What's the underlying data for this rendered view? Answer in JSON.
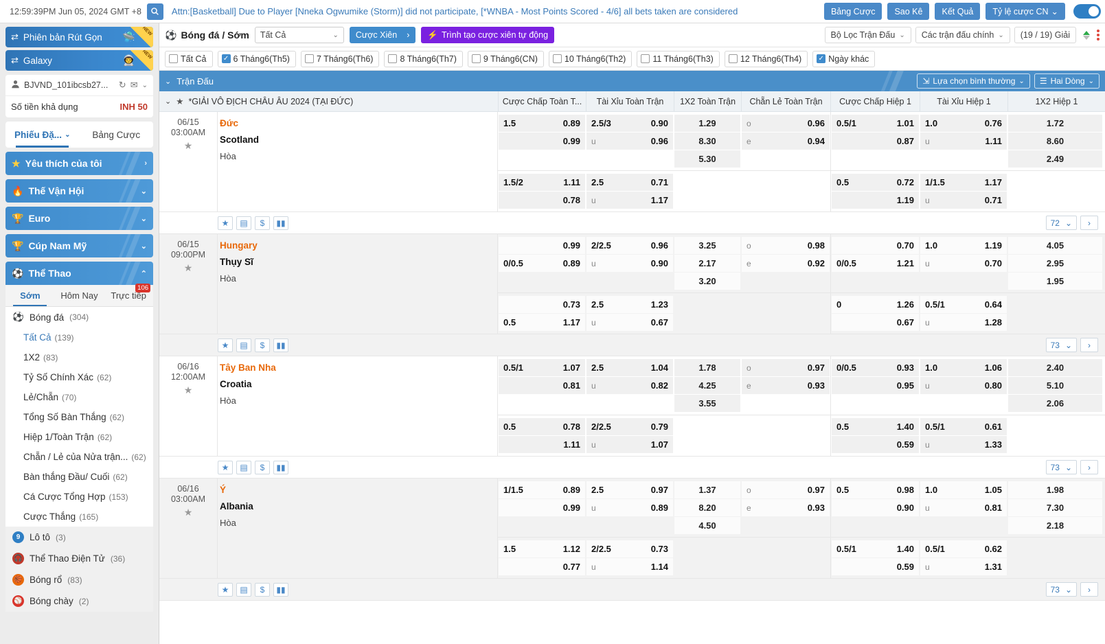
{
  "topbar": {
    "clock": "12:59:39PM Jun 05, 2024 GMT +8",
    "search_icon": "search-icon",
    "announcement": "Attn:[Basketball] Due to Player [Nneka Ogwumike (Storm)] did not participate, [*WNBA - Most Points Scored - 4/6] all bets taken are considered",
    "buttons": [
      {
        "label": "Bảng Cược"
      },
      {
        "label": "Sao Kê"
      },
      {
        "label": "Kết Quả"
      },
      {
        "label": "Tỷ lệ cược CN",
        "caret": "⌄"
      }
    ]
  },
  "sidebar": {
    "promos": [
      {
        "label": "Phiên bản Rút Gọn",
        "flag": "NEW",
        "icon": "swap-icon",
        "deco": "🛸"
      },
      {
        "label": "Galaxy",
        "flag": "NEW",
        "icon": "swap-icon",
        "deco": "👨‍🚀"
      }
    ],
    "account": {
      "name": "BJVND_101ibcsb27...",
      "refresh_icon": "refresh-icon",
      "mail_icon": "mail-icon",
      "caret_icon": "chevron-down-icon",
      "balance_label": "Số tiền khả dụng",
      "balance_value": "INH 50"
    },
    "bet_tabs": [
      {
        "label": "Phiếu Đặ...",
        "active": true,
        "caret": "⌄"
      },
      {
        "label": "Bảng Cược",
        "active": false
      }
    ],
    "nav_groups": [
      {
        "label": "Yêu thích của tôi",
        "icon": "star-icon",
        "caret": "›"
      },
      {
        "label": "Thế Vận Hội",
        "icon": "torch-icon",
        "caret": "⌄"
      },
      {
        "label": "Euro",
        "icon": "trophy-icon",
        "caret": "⌄"
      },
      {
        "label": "Cúp Nam Mỹ",
        "icon": "cup-icon",
        "caret": "⌄"
      }
    ],
    "sports_group": {
      "label": "Thể Thao",
      "icon": "soccer-ball-icon",
      "caret": "⌃",
      "subtabs": [
        {
          "label": "Sớm",
          "active": true
        },
        {
          "label": "Hôm Nay",
          "active": false
        },
        {
          "label": "Trực tiếp",
          "active": false,
          "badge": "106"
        }
      ],
      "primary": {
        "label": "Bóng đá",
        "count": "(304)",
        "icon": "soccer-ball-icon"
      },
      "markets": [
        {
          "label": "Tất Cả",
          "count": "(139)",
          "selected": true
        },
        {
          "label": "1X2",
          "count": "(83)",
          "selected": false
        },
        {
          "label": "Tỷ Số Chính Xác",
          "count": "(62)",
          "selected": false
        },
        {
          "label": "Lẻ/Chẵn",
          "count": "(70)",
          "selected": false
        },
        {
          "label": "Tổng Số Bàn Thắng",
          "count": "(62)",
          "selected": false
        },
        {
          "label": "Hiệp 1/Toàn Trận",
          "count": "(62)",
          "selected": false
        },
        {
          "label": "Chẵn / Lẻ của Nửa trận...",
          "count": "(62)",
          "selected": false
        },
        {
          "label": "Bàn thắng Đầu/ Cuối",
          "count": "(62)",
          "selected": false
        },
        {
          "label": "Cá Cược Tổng Hợp",
          "count": "(153)",
          "selected": false
        },
        {
          "label": "Cược Thắng",
          "count": "(165)",
          "selected": false
        }
      ],
      "other_sports": [
        {
          "label": "Lô tô",
          "count": "(3)",
          "icon": "lotto-icon",
          "color": "#2f7fc4"
        },
        {
          "label": "Thể Thao Điện Tử",
          "count": "(36)",
          "icon": "headset-icon",
          "color": "#c0392b"
        },
        {
          "label": "Bóng rổ",
          "count": "(83)",
          "icon": "basketball-icon",
          "color": "#e8690b"
        },
        {
          "label": "Bóng chày",
          "count": "(2)",
          "icon": "baseball-icon",
          "color": "#d9352c"
        }
      ]
    }
  },
  "subbar": {
    "title": "Bóng đá / Sớm",
    "title_icon": "soccer-ball-icon",
    "filter_value": "Tất Cả",
    "parlay_label": "Cược Xiên",
    "parlay_arrow": "›",
    "auto_parlay_label": "Trình tạo cược xiên tự động",
    "auto_parlay_icon": "lightning-icon",
    "match_filter_label": "Bộ Lọc Trận Đấu",
    "main_matches_label": "Các trận đấu chính",
    "league_count_label": "(19 / 19) Giải",
    "sort_icon": "sort-arrows-icon"
  },
  "dates": [
    {
      "label": "Tất Cả",
      "checked": false
    },
    {
      "label": "6 Tháng6(Th5)",
      "checked": true
    },
    {
      "label": "7 Tháng6(Th6)",
      "checked": false
    },
    {
      "label": "8 Tháng6(Th7)",
      "checked": false
    },
    {
      "label": "9 Tháng6(CN)",
      "checked": false
    },
    {
      "label": "10 Tháng6(Th2)",
      "checked": false
    },
    {
      "label": "11 Tháng6(Th3)",
      "checked": false
    },
    {
      "label": "12 Tháng6(Th4)",
      "checked": false
    },
    {
      "label": "Ngày khác",
      "checked": true
    }
  ],
  "table_header": {
    "caret": "⌄",
    "label": "Trận Đấu",
    "view_option_label": "Lựa chọn bình thường",
    "view_option_icon": "filter-lines-icon",
    "rows_label": "Hai Dòng",
    "rows_icon": "list-icon"
  },
  "league": {
    "caret": "⌄",
    "star_icon": "star-icon",
    "name": "*GIẢI VÔ ĐỊCH CHÂU ÂU 2024 (TẠI ĐỨC)",
    "columns": [
      "Cược Chấp Toàn T...",
      "Tài Xỉu Toàn Trận",
      "1X2 Toàn Trận",
      "Chẵn Lẻ Toàn Trận",
      "Cược Chấp Hiệp 1",
      "Tài Xỉu Hiệp 1",
      "1X2 Hiệp 1"
    ]
  },
  "action_icons": [
    {
      "name": "star-icon",
      "glyph": "★"
    },
    {
      "name": "stack-icon",
      "glyph": "▤"
    },
    {
      "name": "dollar-icon",
      "glyph": "$"
    },
    {
      "name": "bar-chart-icon",
      "glyph": "▮▮"
    }
  ],
  "matches": [
    {
      "date": "06/15",
      "time": "03:00AM",
      "home": "Đức",
      "away": "Scotland",
      "draw": "Hòa",
      "alt": false,
      "pager_value": "72",
      "full": {
        "handicap": [
          {
            "hd": "1.5",
            "val": "0.89"
          },
          {
            "hd": "",
            "val": "0.99"
          }
        ],
        "overunder": [
          {
            "hd": "2.5/3",
            "val": "0.90"
          },
          {
            "hd": "u",
            "val": "0.96"
          }
        ],
        "onextwo": [
          "1.29",
          "8.30",
          "5.30"
        ],
        "oddeven": [
          {
            "hd": "o",
            "val": "0.96"
          },
          {
            "hd": "e",
            "val": "0.94"
          }
        ],
        "h1_handicap": [
          {
            "hd": "0.5/1",
            "val": "1.01"
          },
          {
            "hd": "",
            "val": "0.87"
          }
        ],
        "h1_overunder": [
          {
            "hd": "1.0",
            "val": "0.76"
          },
          {
            "hd": "u",
            "val": "1.11"
          }
        ],
        "h1_onextwo": [
          "1.72",
          "8.60",
          "2.49"
        ]
      },
      "second": {
        "handicap": [
          {
            "hd": "1.5/2",
            "val": "1.11"
          },
          {
            "hd": "",
            "val": "0.78"
          }
        ],
        "overunder": [
          {
            "hd": "2.5",
            "val": "0.71"
          },
          {
            "hd": "u",
            "val": "1.17"
          }
        ],
        "h1_handicap": [
          {
            "hd": "0.5",
            "val": "0.72"
          },
          {
            "hd": "",
            "val": "1.19"
          }
        ],
        "h1_overunder": [
          {
            "hd": "1/1.5",
            "val": "1.17"
          },
          {
            "hd": "u",
            "val": "0.71"
          }
        ]
      }
    },
    {
      "date": "06/15",
      "time": "09:00PM",
      "home": "Hungary",
      "away": "Thụy Sĩ",
      "draw": "Hòa",
      "alt": true,
      "home_highlight": false,
      "pager_value": "73",
      "full": {
        "handicap": [
          {
            "hd": "",
            "val": "0.99"
          },
          {
            "hd": "0/0.5",
            "val": "0.89"
          }
        ],
        "overunder": [
          {
            "hd": "2/2.5",
            "val": "0.96"
          },
          {
            "hd": "u",
            "val": "0.90"
          }
        ],
        "onextwo": [
          "3.25",
          "2.17",
          "3.20"
        ],
        "oddeven": [
          {
            "hd": "o",
            "val": "0.98"
          },
          {
            "hd": "e",
            "val": "0.92"
          }
        ],
        "h1_handicap": [
          {
            "hd": "",
            "val": "0.70"
          },
          {
            "hd": "0/0.5",
            "val": "1.21"
          }
        ],
        "h1_overunder": [
          {
            "hd": "1.0",
            "val": "1.19"
          },
          {
            "hd": "u",
            "val": "0.70"
          }
        ],
        "h1_onextwo": [
          "4.05",
          "2.95",
          "1.95"
        ]
      },
      "second": {
        "handicap": [
          {
            "hd": "",
            "val": "0.73"
          },
          {
            "hd": "0.5",
            "val": "1.17"
          }
        ],
        "overunder": [
          {
            "hd": "2.5",
            "val": "1.23"
          },
          {
            "hd": "u",
            "val": "0.67"
          }
        ],
        "h1_handicap": [
          {
            "hd": "0",
            "val": "1.26"
          },
          {
            "hd": "",
            "val": "0.67"
          }
        ],
        "h1_overunder": [
          {
            "hd": "0.5/1",
            "val": "0.64"
          },
          {
            "hd": "u",
            "val": "1.28"
          }
        ]
      }
    },
    {
      "date": "06/16",
      "time": "12:00AM",
      "home": "Tây Ban Nha",
      "away": "Croatia",
      "draw": "Hòa",
      "alt": false,
      "pager_value": "73",
      "full": {
        "handicap": [
          {
            "hd": "0.5/1",
            "val": "1.07"
          },
          {
            "hd": "",
            "val": "0.81"
          }
        ],
        "overunder": [
          {
            "hd": "2.5",
            "val": "1.04"
          },
          {
            "hd": "u",
            "val": "0.82"
          }
        ],
        "onextwo": [
          "1.78",
          "4.25",
          "3.55"
        ],
        "oddeven": [
          {
            "hd": "o",
            "val": "0.97"
          },
          {
            "hd": "e",
            "val": "0.93"
          }
        ],
        "h1_handicap": [
          {
            "hd": "0/0.5",
            "val": "0.93"
          },
          {
            "hd": "",
            "val": "0.95"
          }
        ],
        "h1_overunder": [
          {
            "hd": "1.0",
            "val": "1.06"
          },
          {
            "hd": "u",
            "val": "0.80"
          }
        ],
        "h1_onextwo": [
          "2.40",
          "5.10",
          "2.06"
        ]
      },
      "second": {
        "handicap": [
          {
            "hd": "0.5",
            "val": "0.78"
          },
          {
            "hd": "",
            "val": "1.11"
          }
        ],
        "overunder": [
          {
            "hd": "2/2.5",
            "val": "0.79"
          },
          {
            "hd": "u",
            "val": "1.07"
          }
        ],
        "h1_handicap": [
          {
            "hd": "0.5",
            "val": "1.40"
          },
          {
            "hd": "",
            "val": "0.59"
          }
        ],
        "h1_overunder": [
          {
            "hd": "0.5/1",
            "val": "0.61"
          },
          {
            "hd": "u",
            "val": "1.33"
          }
        ]
      }
    },
    {
      "date": "06/16",
      "time": "03:00AM",
      "home": "Ý",
      "away": "Albania",
      "draw": "Hòa",
      "alt": true,
      "pager_value": "73",
      "full": {
        "handicap": [
          {
            "hd": "1/1.5",
            "val": "0.89"
          },
          {
            "hd": "",
            "val": "0.99"
          }
        ],
        "overunder": [
          {
            "hd": "2.5",
            "val": "0.97"
          },
          {
            "hd": "u",
            "val": "0.89"
          }
        ],
        "onextwo": [
          "1.37",
          "8.20",
          "4.50"
        ],
        "oddeven": [
          {
            "hd": "o",
            "val": "0.97"
          },
          {
            "hd": "e",
            "val": "0.93"
          }
        ],
        "h1_handicap": [
          {
            "hd": "0.5",
            "val": "0.98"
          },
          {
            "hd": "",
            "val": "0.90"
          }
        ],
        "h1_overunder": [
          {
            "hd": "1.0",
            "val": "1.05"
          },
          {
            "hd": "u",
            "val": "0.81"
          }
        ],
        "h1_onextwo": [
          "1.98",
          "7.30",
          "2.18"
        ]
      },
      "second": {
        "handicap": [
          {
            "hd": "1.5",
            "val": "1.12"
          },
          {
            "hd": "",
            "val": "0.77"
          }
        ],
        "overunder": [
          {
            "hd": "2/2.5",
            "val": "0.73"
          },
          {
            "hd": "u",
            "val": "1.14"
          }
        ],
        "h1_handicap": [
          {
            "hd": "0.5/1",
            "val": "1.40"
          },
          {
            "hd": "",
            "val": "0.59"
          }
        ],
        "h1_overunder": [
          {
            "hd": "0.5/1",
            "val": "0.62"
          },
          {
            "hd": "u",
            "val": "1.31"
          }
        ]
      }
    }
  ]
}
